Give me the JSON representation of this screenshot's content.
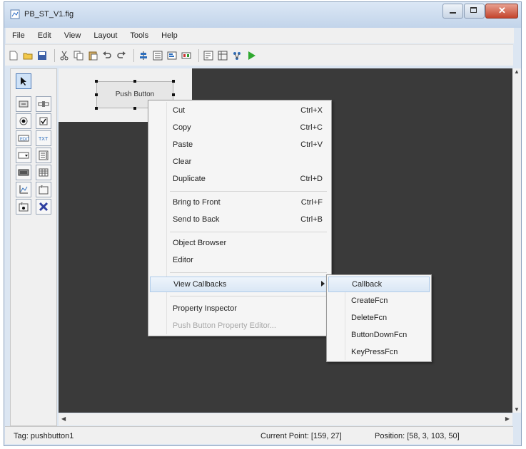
{
  "window": {
    "title": "PB_ST_V1.fig"
  },
  "menubar": [
    "File",
    "Edit",
    "View",
    "Layout",
    "Tools",
    "Help"
  ],
  "toolbar": {
    "icons": [
      "new-icon",
      "open-icon",
      "save-icon",
      "cut-icon",
      "copy-icon",
      "paste-icon",
      "undo-icon",
      "redo-icon",
      "align-icon",
      "menu-editor-icon",
      "tab-order-icon",
      "toolbar-editor-icon",
      "mfile-editor-icon",
      "property-inspector-icon",
      "object-browser-icon",
      "run-icon"
    ]
  },
  "palette": {
    "tools": [
      "select-arrow",
      "push-button",
      "slider",
      "radio-button",
      "check-box",
      "edit-text",
      "static-text",
      "popup-menu",
      "listbox",
      "toggle-button",
      "table",
      "axes",
      "panel",
      "button-group",
      "activex-control"
    ]
  },
  "canvas": {
    "push_button_label": "Push Button"
  },
  "context_menu": {
    "items": [
      {
        "label": "Cut",
        "shortcut": "Ctrl+X"
      },
      {
        "label": "Copy",
        "shortcut": "Ctrl+C"
      },
      {
        "label": "Paste",
        "shortcut": "Ctrl+V"
      },
      {
        "label": "Clear",
        "shortcut": ""
      },
      {
        "label": "Duplicate",
        "shortcut": "Ctrl+D"
      },
      {
        "label": "Bring to Front",
        "shortcut": "Ctrl+F"
      },
      {
        "label": "Send to Back",
        "shortcut": "Ctrl+B"
      },
      {
        "label": "Object Browser",
        "shortcut": ""
      },
      {
        "label": "Editor",
        "shortcut": ""
      },
      {
        "label": "View Callbacks",
        "shortcut": ""
      },
      {
        "label": "Property Inspector",
        "shortcut": ""
      },
      {
        "label": "Push Button Property Editor...",
        "shortcut": ""
      }
    ]
  },
  "submenu": {
    "items": [
      {
        "label": "Callback"
      },
      {
        "label": "CreateFcn"
      },
      {
        "label": "DeleteFcn"
      },
      {
        "label": "ButtonDownFcn"
      },
      {
        "label": "KeyPressFcn"
      }
    ]
  },
  "status": {
    "tag": "Tag: pushbutton1",
    "current_point": "Current Point: [159, 27]",
    "position": "Position: [58, 3, 103, 50]"
  },
  "colors": {
    "canvas_bg": "#3a3a3a",
    "figure_bg": "#f0f0f0",
    "run_green": "#2fa82f"
  }
}
